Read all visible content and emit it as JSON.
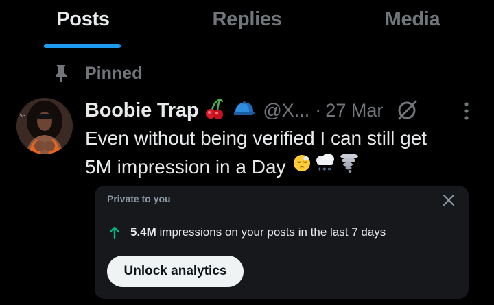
{
  "tabs": [
    {
      "label": "Posts",
      "active": true
    },
    {
      "label": "Replies",
      "active": false
    },
    {
      "label": "Media",
      "active": false
    }
  ],
  "accent_color": "#1d9bf0",
  "pinned": {
    "label": "Pinned",
    "icon": "pin-icon"
  },
  "post": {
    "author_name": "Boobie Trap",
    "name_emojis": [
      "cherries",
      "blue-cap"
    ],
    "handle": "@X...",
    "separator": "·",
    "date": "27 Mar",
    "text_line1": "Even without being verified I can still get",
    "text_line2": "5M impression in a Day",
    "text_emojis": [
      "sleepy-face",
      "snow-cloud",
      "tornado"
    ]
  },
  "analytics_card": {
    "private_label": "Private to you",
    "impressions_value": "5.4M",
    "impressions_suffix": " impressions on your posts in the last 7 days",
    "trend_color": "#00ba7c",
    "unlock_label": "Unlock analytics"
  }
}
